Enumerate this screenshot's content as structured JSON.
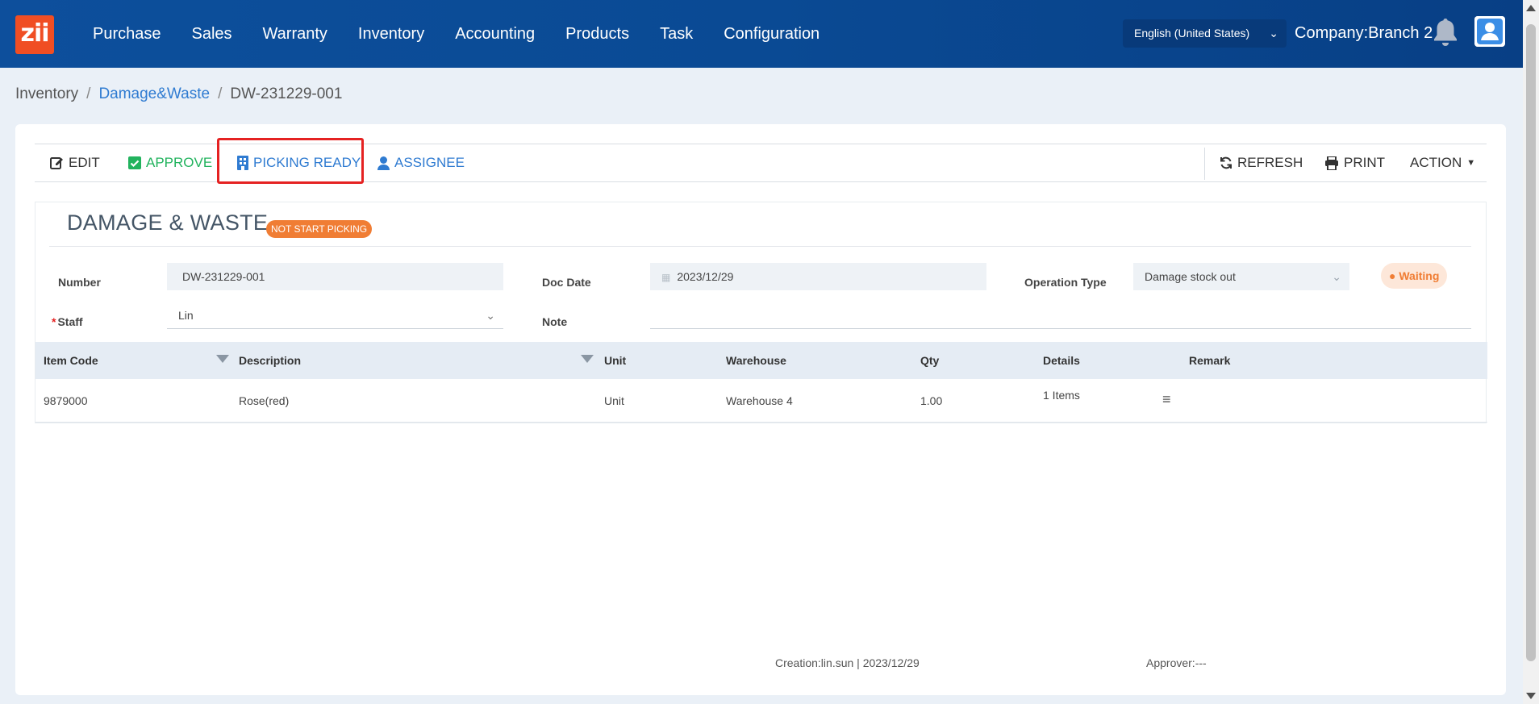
{
  "app": {
    "logo_text": "zii"
  },
  "nav": {
    "items": [
      "Purchase",
      "Sales",
      "Warranty",
      "Inventory",
      "Accounting",
      "Products",
      "Task",
      "Configuration"
    ],
    "language": "English (United States)",
    "company": "Company:Branch 2"
  },
  "breadcrumb": {
    "root": "Inventory",
    "section": "Damage&Waste",
    "current": "DW-231229-001"
  },
  "toolbar": {
    "edit": "EDIT",
    "approve": "APPROVE",
    "picking_ready": "PICKING READY",
    "assignee": "ASSIGNEE",
    "refresh": "REFRESH",
    "print": "PRINT",
    "action": "ACTION"
  },
  "doc": {
    "title": "DAMAGE & WASTE",
    "badge": "NOT START PICKING",
    "status": "Waiting",
    "fields": {
      "number_label": "Number",
      "number_value": "DW-231229-001",
      "doc_date_label": "Doc Date",
      "doc_date_value": "2023/12/29",
      "operation_type_label": "Operation Type",
      "operation_type_value": "Damage stock out",
      "staff_label": "Staff",
      "staff_value": "Lin",
      "note_label": "Note",
      "note_value": ""
    }
  },
  "table": {
    "columns": [
      "Item Code",
      "Description",
      "Unit",
      "Warehouse",
      "Qty",
      "Details",
      "Remark"
    ],
    "rows": [
      {
        "item_code": "9879000",
        "description": "Rose(red)",
        "unit": "Unit",
        "warehouse": "Warehouse 4",
        "qty": "1.00",
        "details": "1 Items",
        "remark": ""
      }
    ]
  },
  "footer": {
    "creation": "Creation:lin.sun | 2023/12/29",
    "approver": "Approver:---"
  },
  "colors": {
    "nav_bg": "#0a4a94",
    "accent": "#2f7bd1",
    "approve": "#22b35e",
    "badge": "#f07d34",
    "highlight": "#e52222"
  }
}
